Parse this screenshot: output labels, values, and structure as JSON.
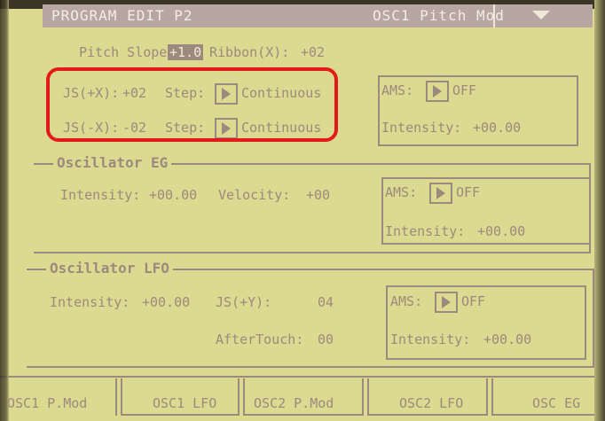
{
  "header": {
    "title": "PROGRAM EDIT P2",
    "page": "OSC1 Pitch Mod"
  },
  "top": {
    "pitch_slope_label": "Pitch Slope:",
    "pitch_slope_value": "+1.0",
    "ribbon_label": "Ribbon(X):",
    "ribbon_value": "+02"
  },
  "joystick": {
    "jsx_pos_label": "JS(+X):",
    "jsx_pos_value": "+02",
    "jsx_neg_label": "JS(-X):",
    "jsx_neg_value": "-02",
    "step_label": "Step:",
    "step_value": "Continuous"
  },
  "ams_common": {
    "ams_label": "AMS:",
    "ams_value": "OFF",
    "intensity_label": "Intensity:",
    "intensity_value": "+00.00"
  },
  "osc_eg": {
    "title": "Oscillator EG",
    "intensity_label": "Intensity:",
    "intensity_value": "+00.00",
    "velocity_label": "Velocity:",
    "velocity_value": "+00"
  },
  "osc_lfo": {
    "title": "Oscillator LFO",
    "intensity_label": "Intensity:",
    "intensity_value": "+00.00",
    "jsy_label": "JS(+Y):",
    "jsy_value": "04",
    "aftertouch_label": "AfterTouch:",
    "aftertouch_value": "00"
  },
  "tabs": [
    "OSC1 P.Mod",
    "OSC1 LFO",
    "OSC2 P.Mod",
    "OSC2 LFO",
    "OSC EG"
  ]
}
